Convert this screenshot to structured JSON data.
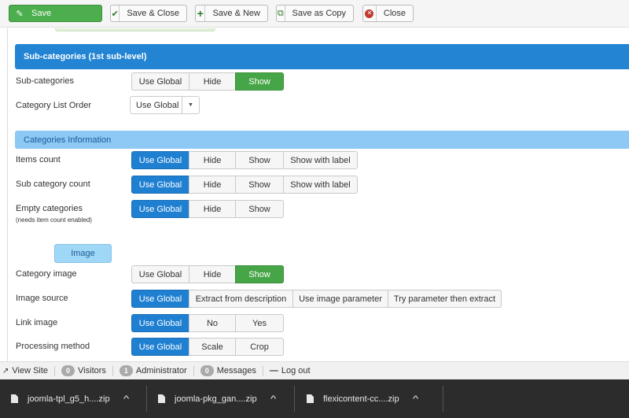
{
  "toolbar": {
    "save_label": "Save",
    "save_close_label": "Save & Close",
    "save_new_label": "Save & New",
    "save_copy_label": "Save as Copy",
    "close_label": "Close"
  },
  "subcategories_section": {
    "title": "Sub-categories (1st sub-level)",
    "subcategories": {
      "label": "Sub-categories",
      "options": [
        "Use Global",
        "Hide",
        "Show"
      ],
      "selected": "Show"
    },
    "list_order": {
      "label": "Category List Order",
      "value": "Use Global"
    }
  },
  "categories_info": {
    "title": "Categories Information",
    "items_count": {
      "label": "Items count",
      "options": [
        "Use Global",
        "Hide",
        "Show",
        "Show with label"
      ],
      "selected": "Use Global"
    },
    "sub_category_count": {
      "label": "Sub category count",
      "options": [
        "Use Global",
        "Hide",
        "Show",
        "Show with label"
      ],
      "selected": "Use Global"
    },
    "empty_categories": {
      "label": "Empty categories",
      "note": "(needs item count enabled)",
      "options": [
        "Use Global",
        "Hide",
        "Show"
      ],
      "selected": "Use Global"
    }
  },
  "image_section": {
    "title": "Image",
    "category_image": {
      "label": "Category image",
      "options": [
        "Use Global",
        "Hide",
        "Show"
      ],
      "selected": "Show"
    },
    "image_source": {
      "label": "Image source",
      "options": [
        "Use Global",
        "Extract from description",
        "Use image parameter",
        "Try parameter then extract"
      ],
      "selected": "Use Global"
    },
    "link_image": {
      "label": "Link image",
      "options": [
        "Use Global",
        "No",
        "Yes"
      ],
      "selected": "Use Global"
    },
    "processing_method": {
      "label": "Processing method",
      "options": [
        "Use Global",
        "Scale",
        "Crop"
      ],
      "selected": "Use Global"
    }
  },
  "statusbar": {
    "view_site": "View Site",
    "visitors_count": "0",
    "visitors_label": "Visitors",
    "admin_count": "1",
    "admin_label": "Administrator",
    "messages_count": "0",
    "messages_label": "Messages",
    "logout": "Log out"
  },
  "downloads": [
    {
      "name": "joomla-tpl_g5_h....zip"
    },
    {
      "name": "joomla-pkg_gan....zip"
    },
    {
      "name": "flexicontent-cc....zip"
    }
  ],
  "colors": {
    "primary_blue": "#1f7fd1",
    "success_green": "#46a546",
    "section_blue": "#2384d3",
    "info_blue": "#8ec8f4"
  }
}
